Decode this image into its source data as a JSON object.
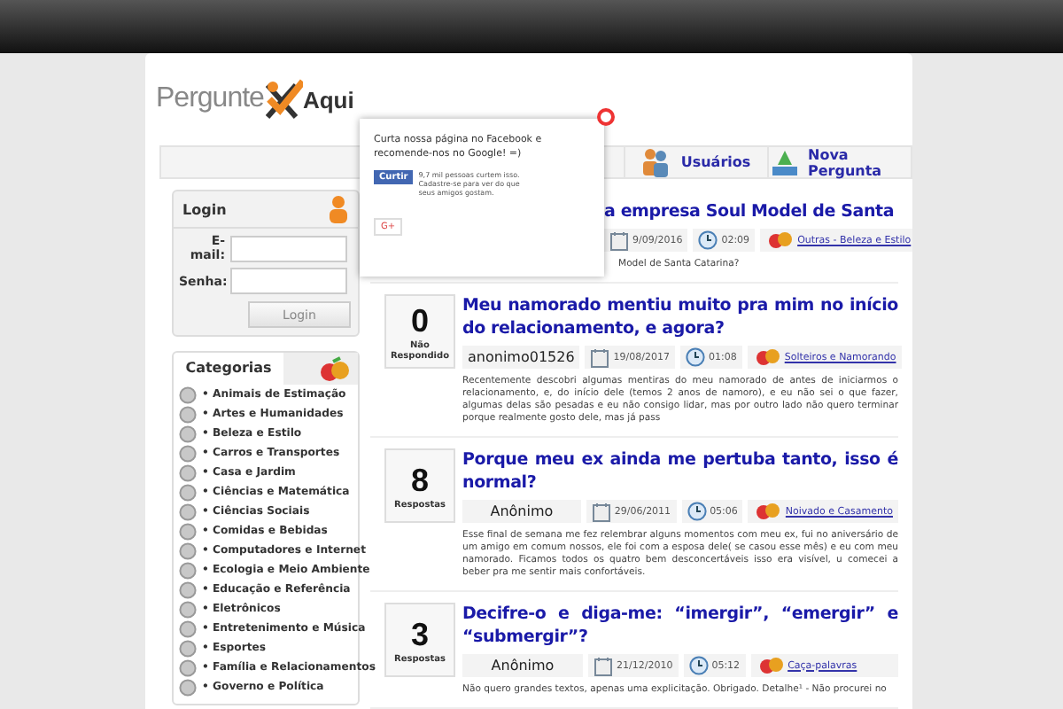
{
  "site": {
    "logo_left": "Pergunte",
    "logo_right": "Aqui"
  },
  "tabs": [
    {
      "label": "Usuários"
    },
    {
      "label": "Nova Pergunta"
    }
  ],
  "login": {
    "title": "Login",
    "email_label": "E-mail:",
    "password_label": "Senha:",
    "button": "Login"
  },
  "categories": {
    "title": "Categorias",
    "items": [
      "• Animais de Estimação",
      "• Artes e Humanidades",
      "• Beleza e Estilo",
      "• Carros e Transportes",
      "• Casa e Jardim",
      "• Ciências e Matemática",
      "• Ciências Sociais",
      "• Comidas e Bebidas",
      "• Computadores e Internet",
      "• Ecologia e Meio Ambiente",
      "• Educação e Referência",
      "• Eletrônicos",
      "• Entretenimento e Música",
      "• Esportes",
      "• Família e Relacionamentos",
      "• Governo e Política"
    ]
  },
  "questions": [
    {
      "title": "a empresa Soul Model de Santa",
      "date": "9/09/2016",
      "time": "02:09",
      "category": "Outras - Beleza e Estilo",
      "excerpt": "Model de Santa Catarina?"
    },
    {
      "count": "0",
      "count_label": "Não Respondido",
      "title": "Meu namorado mentiu muito pra mim no início do relacionamento, e agora?",
      "author": "anonimo01526",
      "date": "19/08/2017",
      "time": "01:08",
      "category": "Solteiros e Namorando",
      "excerpt": "Recentemente descobri algumas mentiras do meu namorado de antes de iniciarmos o relacionamento, e, do início dele (temos 2 anos de namoro), e eu não sei o que fazer, algumas delas são pesadas e eu não consigo lidar, mas por outro lado não quero terminar porque realmente gosto dele, mas já pass"
    },
    {
      "count": "8",
      "count_label": "Respostas",
      "title": "Porque meu ex ainda me pertuba tanto, isso é normal?",
      "author": "Anônimo",
      "date": "29/06/2011",
      "time": "05:06",
      "category": "Noivado e Casamento",
      "excerpt": "Esse final de semana me fez relembrar alguns momentos com meu ex, fui no aniversário de um amigo em comum nossos, ele foi com a esposa dele( se casou esse mês) e eu com meu namorado. Ficamos todos os quatro bem desconcertáveis isso era visível, u comecei a beber pra me sentir mais confortáveis."
    },
    {
      "count": "3",
      "count_label": "Respostas",
      "title": "Decifre-o e diga-me: “imergir”, “emergir” e “submergir”?",
      "author": "Anônimo",
      "date": "21/12/2010",
      "time": "05:12",
      "category": "Caça-palavras",
      "excerpt": "Não quero grandes textos, apenas uma explicitação. Obrigado. Detalhe¹ - Não procurei no"
    }
  ],
  "popup": {
    "text": "Curta nossa página no Facebook e recomende-nos no Google! =)",
    "like_button": "Curtir",
    "like_text": "9,7 mil pessoas curtem isso. Cadastre-se para ver do que seus amigos gostam.",
    "gplus_button": "G+"
  }
}
